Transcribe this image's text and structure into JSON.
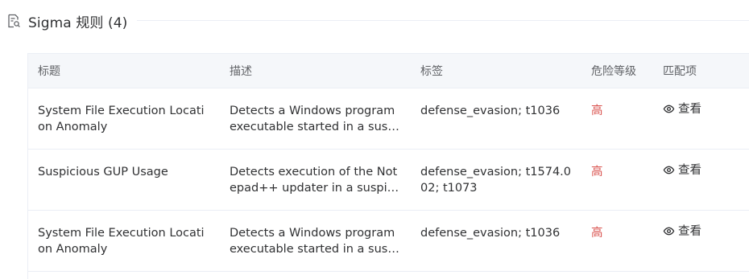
{
  "section": {
    "title": "Sigma 规则 (4)",
    "icon": "document-search-icon"
  },
  "table": {
    "headers": [
      "标题",
      "描述",
      "标签",
      "危险等级",
      "匹配项"
    ],
    "rows": [
      {
        "title": "System File Execution Location Anomaly",
        "description": "Detects a Windows program executable started in a suspicious folder",
        "tags": "defense_evasion; t1036",
        "level": "高",
        "action": "查看"
      },
      {
        "title": "Suspicious GUP Usage",
        "description": "Detects execution of the Notepad++ updater in a suspicious directory",
        "tags": "defense_evasion; t1574.002; t1073",
        "level": "高",
        "action": "查看"
      },
      {
        "title": "System File Execution Location Anomaly",
        "description": "Detects a Windows program executable started in a suspicious folder",
        "tags": "defense_evasion; t1036",
        "level": "高",
        "action": "查看"
      }
    ]
  },
  "colors": {
    "danger": "#d9534f",
    "header_bg": "#f5f7fa",
    "border": "#ebeef5"
  }
}
